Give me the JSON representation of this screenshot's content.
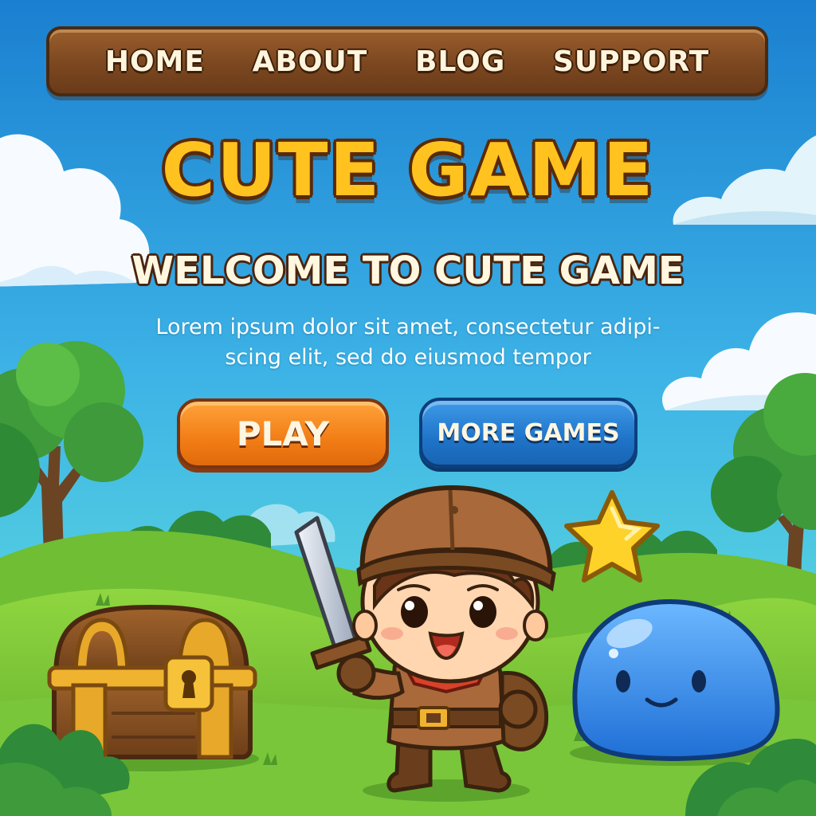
{
  "nav": {
    "items": [
      "HOME",
      "ABOUT",
      "BLOG",
      "SUPPORT"
    ]
  },
  "hero": {
    "title": "CUTE GAME",
    "subtitle": "WELCOME TO CUTE GAME",
    "description": "Lorem ipsum dolor sit amet, consectetur adipi-scing elit, sed do eiusmod tempor"
  },
  "buttons": {
    "play_label": "PLAY",
    "more_games_label": "MORE GAMES"
  },
  "illustration": {
    "icons": [
      "cloud-icon",
      "tree-icon",
      "treasure-chest-icon",
      "adventurer-character-icon",
      "sword-icon",
      "star-icon",
      "blue-slime-icon",
      "bush-icon"
    ]
  },
  "colors": {
    "sky_top": "#1a7fd0",
    "sky_bottom": "#4fd0e0",
    "grass": "#7cc83a",
    "nav_wood": "#7b4720",
    "title_yellow": "#ffc21f",
    "play_orange": "#f27d16",
    "more_blue": "#1f74c8"
  }
}
